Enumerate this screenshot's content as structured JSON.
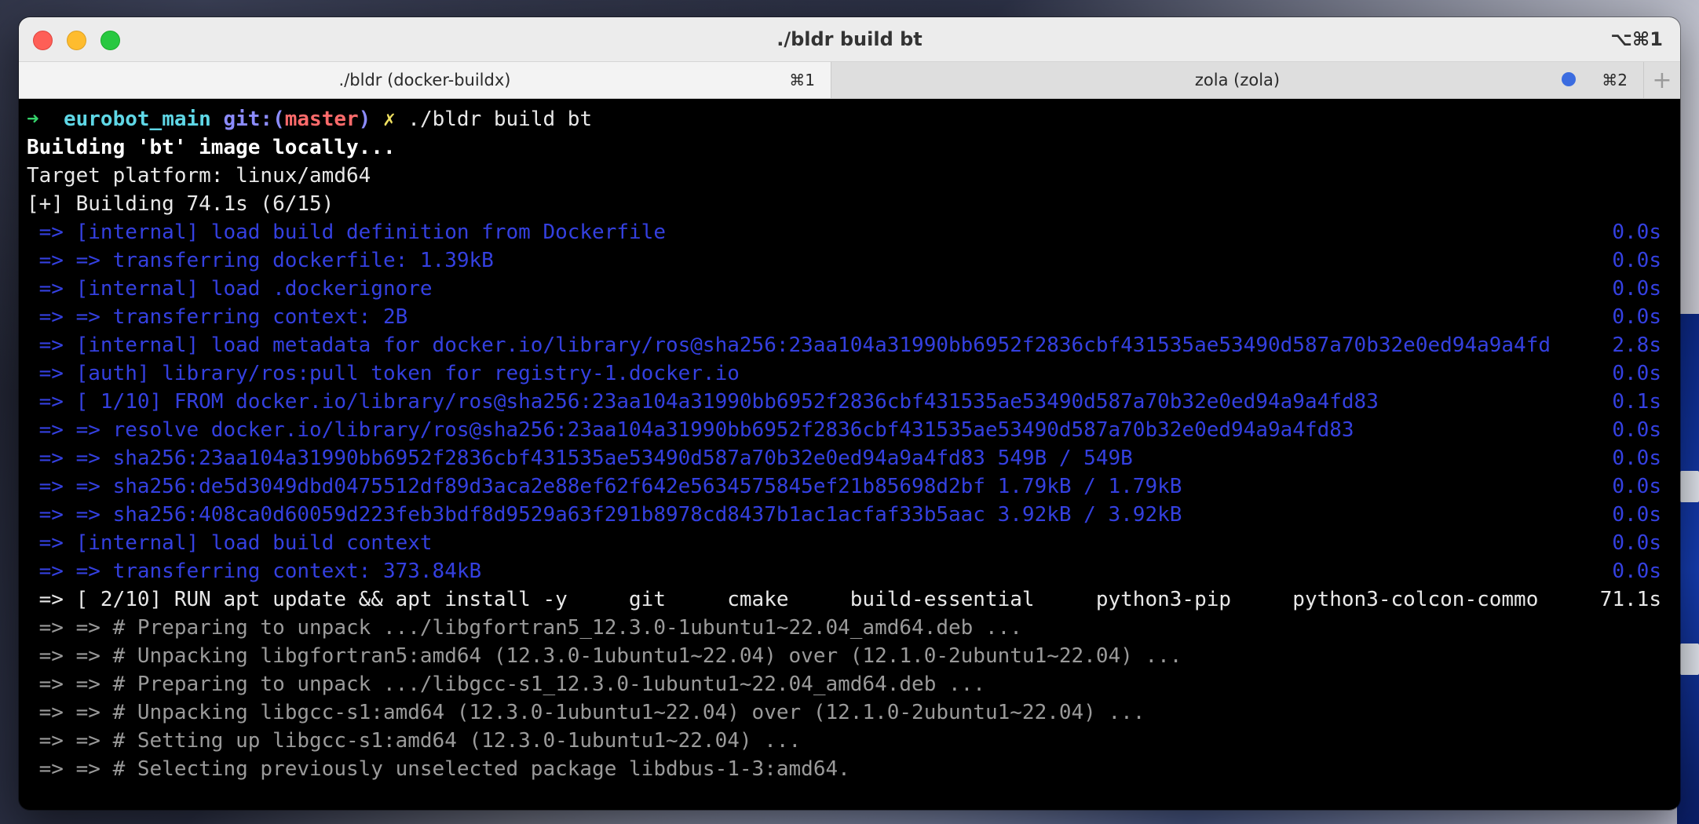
{
  "window": {
    "title": "./bldr build bt",
    "shortcut": "⌥⌘1"
  },
  "tabs": [
    {
      "label": "./bldr (docker-buildx)",
      "shortcut": "⌘1",
      "active": true
    },
    {
      "label": "zola (zola)",
      "shortcut": "⌘2",
      "active": false
    }
  ],
  "tab_add_label": "+",
  "prompt": {
    "arrow": "➜",
    "dir": "eurobot_main",
    "git_label": "git:(",
    "branch": "master",
    "git_close": ")",
    "dirty": "✗",
    "command": "./bldr build bt"
  },
  "lines": [
    {
      "text": "Building 'bt' image locally...",
      "time": "",
      "style": "wb"
    },
    {
      "text": "Target platform: linux/amd64",
      "time": "",
      "style": "w"
    },
    {
      "text": "[+] Building 74.1s (6/15)",
      "time": "",
      "style": "w"
    },
    {
      "text": " => [internal] load build definition from Dockerfile",
      "time": "0.0s",
      "style": "blue"
    },
    {
      "text": " => => transferring dockerfile: 1.39kB",
      "time": "0.0s",
      "style": "blue"
    },
    {
      "text": " => [internal] load .dockerignore",
      "time": "0.0s",
      "style": "blue"
    },
    {
      "text": " => => transferring context: 2B",
      "time": "0.0s",
      "style": "blue"
    },
    {
      "text": " => [internal] load metadata for docker.io/library/ros@sha256:23aa104a31990bb6952f2836cbf431535ae53490d587a70b32e0ed94a9a4fd",
      "time": "2.8s",
      "style": "blue"
    },
    {
      "text": " => [auth] library/ros:pull token for registry-1.docker.io",
      "time": "0.0s",
      "style": "blue"
    },
    {
      "text": " => [ 1/10] FROM docker.io/library/ros@sha256:23aa104a31990bb6952f2836cbf431535ae53490d587a70b32e0ed94a9a4fd83",
      "time": "0.1s",
      "style": "blue"
    },
    {
      "text": " => => resolve docker.io/library/ros@sha256:23aa104a31990bb6952f2836cbf431535ae53490d587a70b32e0ed94a9a4fd83",
      "time": "0.0s",
      "style": "blue"
    },
    {
      "text": " => => sha256:23aa104a31990bb6952f2836cbf431535ae53490d587a70b32e0ed94a9a4fd83 549B / 549B",
      "time": "0.0s",
      "style": "blue"
    },
    {
      "text": " => => sha256:de5d3049dbd0475512df89d3aca2e88ef62f642e5634575845ef21b85698d2bf 1.79kB / 1.79kB",
      "time": "0.0s",
      "style": "blue"
    },
    {
      "text": " => => sha256:408ca0d60059d223feb3bdf8d9529a63f291b8978cd8437b1ac1acfaf33b5aac 3.92kB / 3.92kB",
      "time": "0.0s",
      "style": "blue"
    },
    {
      "text": " => [internal] load build context",
      "time": "0.0s",
      "style": "blue"
    },
    {
      "text": " => => transferring context: 373.84kB",
      "time": "0.0s",
      "style": "blue"
    },
    {
      "text": " => [ 2/10] RUN apt update && apt install -y     git     cmake     build-essential     python3-pip     python3-colcon-commo",
      "time": "71.1s",
      "style": "w"
    },
    {
      "text": " => => # Preparing to unpack .../libgfortran5_12.3.0-1ubuntu1~22.04_amd64.deb ...",
      "time": "",
      "style": "gray"
    },
    {
      "text": " => => # Unpacking libgfortran5:amd64 (12.3.0-1ubuntu1~22.04) over (12.1.0-2ubuntu1~22.04) ...",
      "time": "",
      "style": "gray"
    },
    {
      "text": " => => # Preparing to unpack .../libgcc-s1_12.3.0-1ubuntu1~22.04_amd64.deb ...",
      "time": "",
      "style": "gray"
    },
    {
      "text": " => => # Unpacking libgcc-s1:amd64 (12.3.0-1ubuntu1~22.04) over (12.1.0-2ubuntu1~22.04) ...",
      "time": "",
      "style": "gray"
    },
    {
      "text": " => => # Setting up libgcc-s1:amd64 (12.3.0-1ubuntu1~22.04) ...",
      "time": "",
      "style": "gray"
    },
    {
      "text": " => => # Selecting previously unselected package libdbus-1-3:amd64.",
      "time": "",
      "style": "gray"
    }
  ]
}
